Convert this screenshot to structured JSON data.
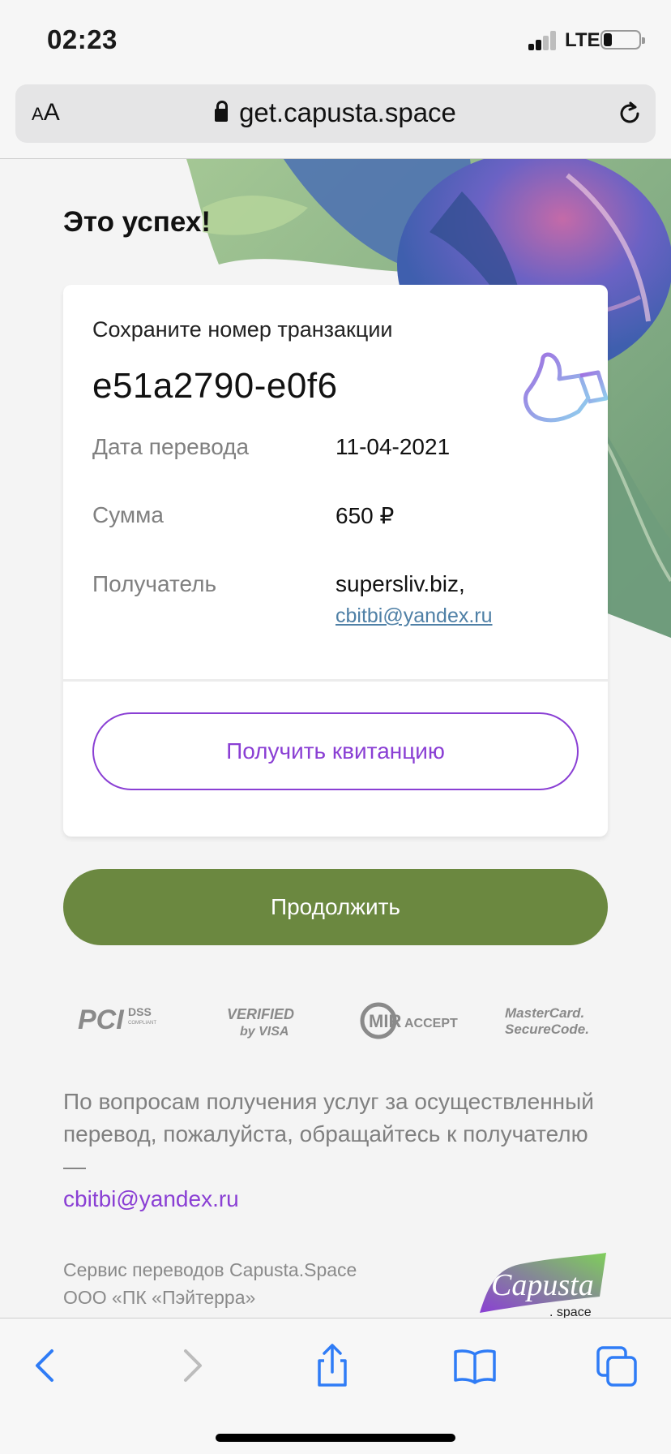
{
  "status_bar": {
    "time": "02:23",
    "network": "LTE"
  },
  "browser": {
    "text_size_button": "AA",
    "url": "get.capusta.space"
  },
  "page": {
    "title": "Это успех!",
    "card": {
      "save_label": "Сохраните номер транзакции",
      "transaction_id": "e51a2790-e0f6",
      "date_label": "Дата перевода",
      "date_value": "11-04-2021",
      "sum_label": "Сумма",
      "sum_value": "650 ₽",
      "recipient_label": "Получатель",
      "recipient_name": "supersliv.biz,",
      "recipient_email": "cbitbi@yandex.ru",
      "receipt_button": "Получить квитанцию"
    },
    "continue_button": "Продолжить",
    "security_logos": {
      "pci": "PCI DSS",
      "visa": "Verified by VISA",
      "mir": "MIR ACCEPT",
      "mastercard": "MasterCard SecureCode"
    },
    "help_text": "По вопросам получения услуг за осуществленный перевод, пожалуйста, обращайтесь к получателю —",
    "help_email": "cbitbi@yandex.ru",
    "footer_line1": "Сервис переводов Capusta.Space",
    "footer_line2": "ООО «ПК «Пэйтерра»",
    "brand_logo": "Capusta",
    "brand_logo_suffix": ". space"
  },
  "colors": {
    "accent_purple": "#8a3fd4",
    "continue_green": "#6b8840",
    "link_blue": "#4f80a6",
    "ios_blue": "#2f7cf6"
  }
}
